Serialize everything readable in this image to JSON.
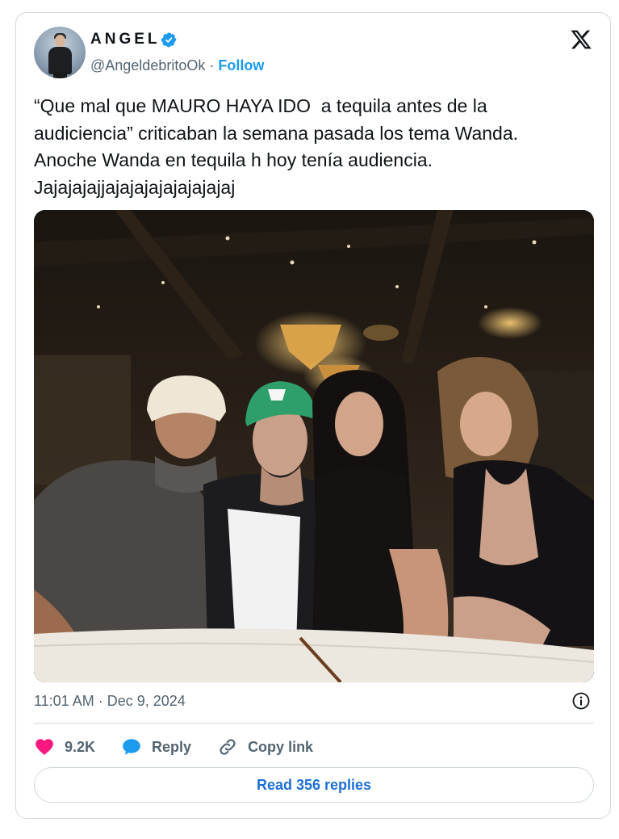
{
  "author": {
    "display_name": "ANGEL",
    "handle": "@AngeldebritoOk",
    "separator": " · ",
    "follow_label": "Follow"
  },
  "tweet": {
    "text": "“Que mal que MAURO HAYA IDO  a tequila antes de la\naudiciencia” criticaban la semana pasada los tema Wanda.\nAnoche Wanda en tequila h hoy tenía audiencia.\nJajajajajjajajajajajajajajaj",
    "timestamp": "11:01 AM · Dec 9, 2024"
  },
  "actions": {
    "likes": "9.2K",
    "reply_label": "Reply",
    "copy_label": "Copy link"
  },
  "read_replies_label": "Read 356 replies",
  "icons": {
    "verified": "verified-badge-icon",
    "brand": "x-logo-icon",
    "info": "info-icon",
    "like": "heart-icon",
    "reply": "speech-bubble-icon",
    "copy": "link-icon"
  },
  "colors": {
    "accent": "#1d9bf0",
    "like": "#f91880",
    "text_secondary": "#536471",
    "border": "#cfd9de"
  }
}
